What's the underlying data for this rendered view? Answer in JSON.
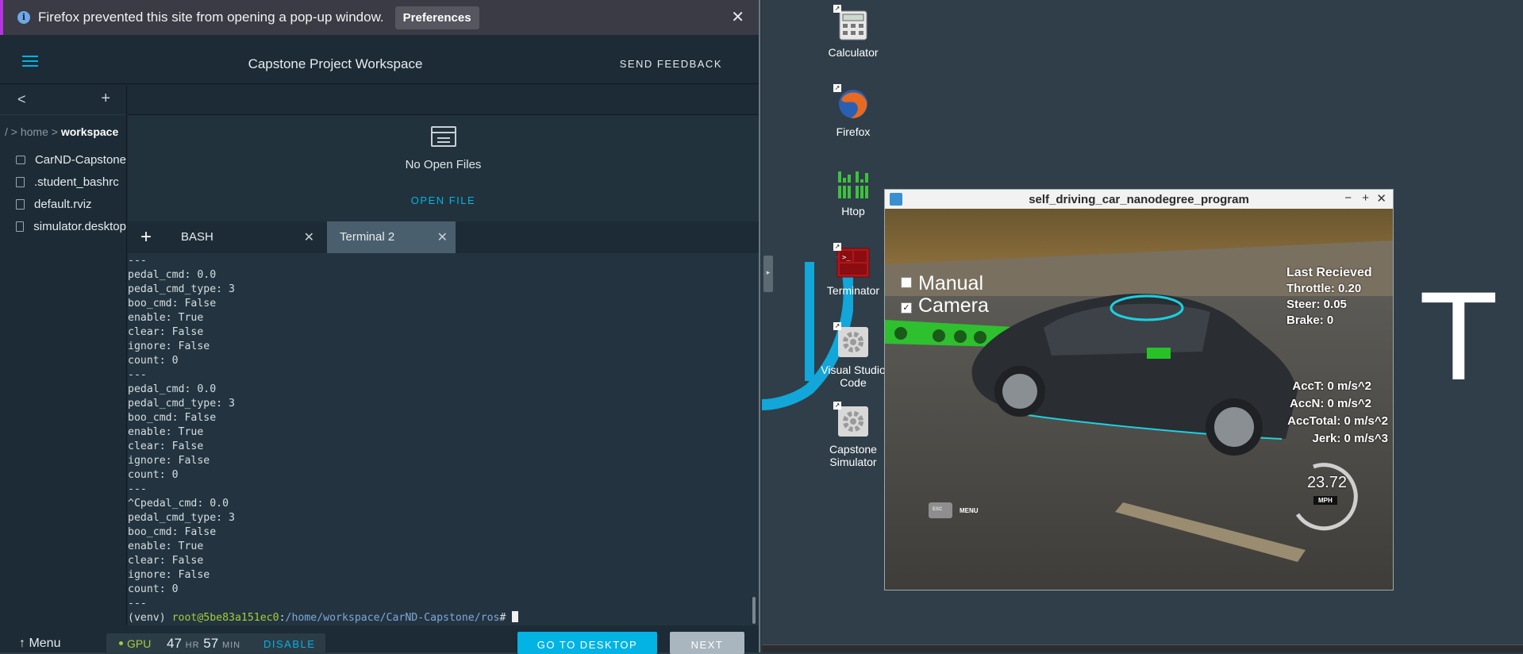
{
  "popup_bar": {
    "message": "Firefox prevented this site from opening a pop-up window.",
    "preferences_label": "Preferences",
    "close_glyph": "✕"
  },
  "header": {
    "title": "Capstone Project Workspace",
    "feedback_label": "SEND FEEDBACK"
  },
  "sidebar": {
    "back_glyph": "<",
    "add_glyph": "+",
    "breadcrumb": {
      "root": "/",
      "sep1": ">",
      "home": "home",
      "sep2": ">",
      "current": "workspace"
    },
    "files": [
      {
        "name": "CarND-Capstone",
        "icon": "folder-icon"
      },
      {
        "name": ".student_bashrc",
        "icon": "file-icon"
      },
      {
        "name": "default.rviz",
        "icon": "file-icon"
      },
      {
        "name": "simulator.desktop",
        "icon": "file-icon"
      }
    ]
  },
  "editor": {
    "empty_message": "No Open Files",
    "open_file_label": "OPEN FILE"
  },
  "tabs": {
    "add_glyph": "+",
    "items": [
      {
        "label": "BASH",
        "close": "✕",
        "active": false
      },
      {
        "label": "Terminal 2",
        "close": "✕",
        "active": true
      }
    ]
  },
  "terminal": {
    "lines": [
      "---",
      "pedal_cmd: 0.0",
      "pedal_cmd_type: 3",
      "boo_cmd: False",
      "enable: True",
      "clear: False",
      "ignore: False",
      "count: 0",
      "---",
      "pedal_cmd: 0.0",
      "pedal_cmd_type: 3",
      "boo_cmd: False",
      "enable: True",
      "clear: False",
      "ignore: False",
      "count: 0",
      "---",
      "^Cpedal_cmd: 0.0",
      "pedal_cmd_type: 3",
      "boo_cmd: False",
      "enable: True",
      "clear: False",
      "ignore: False",
      "count: 0",
      "---"
    ],
    "prompt": {
      "venv": "(venv) ",
      "user": "root@5be83a151ec0",
      "colon": ":",
      "path": "/home/workspace/CarND-Capstone/ros",
      "suffix": "# "
    }
  },
  "footer": {
    "menu_label": "Menu",
    "gpu_label": "GPU",
    "hours": "47",
    "hours_unit": "HR",
    "minutes": "57",
    "minutes_unit": "MIN",
    "disable_label": "DISABLE",
    "desktop_label": "GO TO DESKTOP",
    "next_label": "NEXT"
  },
  "desktop": {
    "icons": [
      {
        "label": "Calculator",
        "icon": "calculator-icon"
      },
      {
        "label": "Firefox",
        "icon": "firefox-icon"
      },
      {
        "label": "Htop",
        "icon": "htop-icon"
      },
      {
        "label": "Terminator",
        "icon": "terminator-icon"
      },
      {
        "label": "Visual Studio Code",
        "icon": "gear-icon"
      },
      {
        "label": "Capstone Simulator",
        "icon": "gear-icon"
      }
    ],
    "big_letter": "T"
  },
  "simulator": {
    "title": "self_driving_car_nanodegree_program",
    "controls": {
      "minimize": "−",
      "maximize": "+",
      "close": "✕"
    },
    "manual_label": "Manual",
    "manual_checked": false,
    "camera_label": "Camera",
    "camera_checked": true,
    "last_received": "Last Recieved",
    "throttle": "Throttle: 0.20",
    "steer": "Steer: 0.05",
    "brake": "Brake: 0",
    "acct": "AccT: 0 m/s^2",
    "accn": "AccN: 0 m/s^2",
    "acctotal": "AccTotal: 0 m/s^2",
    "jerk": "Jerk: 0 m/s^3",
    "speed": "23.72",
    "speed_unit": "MPH",
    "esc_label": "ESC",
    "menu_label": "MENU"
  }
}
